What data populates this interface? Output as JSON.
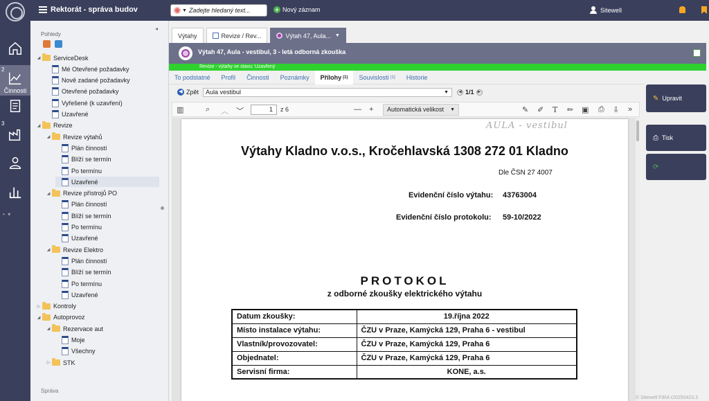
{
  "app": {
    "title": "Rektorát - správa budov"
  },
  "search": {
    "placeholder": "Zadejte hledaný text..."
  },
  "toolbar": {
    "new_record_label": "Nový záznam"
  },
  "user": {
    "name": "Sitewell"
  },
  "rail": {
    "items": [
      {
        "name": "home",
        "icon": "home-icon",
        "num": ""
      },
      {
        "name": "activities",
        "icon": "chart-line-icon",
        "num": "2",
        "label": "Činnosti"
      },
      {
        "name": "documents",
        "icon": "document-icon",
        "num": ""
      },
      {
        "name": "factory",
        "icon": "factory-icon",
        "num": "3"
      },
      {
        "name": "person",
        "icon": "person-icon",
        "num": ""
      },
      {
        "name": "stats",
        "icon": "bar-chart-icon",
        "num": ""
      }
    ]
  },
  "tree": {
    "header": "Pohledy",
    "footer": "Správa",
    "nodes": [
      {
        "label": "ServiceDesk",
        "type": "folder",
        "depth": 0,
        "expanded": true
      },
      {
        "label": "Mé Otevřené požadavky",
        "type": "doc",
        "depth": 1
      },
      {
        "label": "Nově zadané požadavky",
        "type": "doc",
        "depth": 1
      },
      {
        "label": "Otevřené požadavky",
        "type": "doc",
        "depth": 1
      },
      {
        "label": "Vyřešené (k uzavření)",
        "type": "doc",
        "depth": 1
      },
      {
        "label": "Uzavřené",
        "type": "doc",
        "depth": 1
      },
      {
        "label": "Revize",
        "type": "folder",
        "depth": 0,
        "expanded": true
      },
      {
        "label": "Revize výtahů",
        "type": "folder",
        "depth": 1,
        "expanded": true
      },
      {
        "label": "Plán činností",
        "type": "doc",
        "depth": 2
      },
      {
        "label": "Blíží se termín",
        "type": "doc",
        "depth": 2
      },
      {
        "label": "Po termínu",
        "type": "doc",
        "depth": 2
      },
      {
        "label": "Uzavřené",
        "type": "doc",
        "depth": 2,
        "selected": true
      },
      {
        "label": "Revize přístrojů PO",
        "type": "folder",
        "depth": 1,
        "expanded": true
      },
      {
        "label": "Plán činností",
        "type": "doc",
        "depth": 2
      },
      {
        "label": "Blíží se termín",
        "type": "doc",
        "depth": 2
      },
      {
        "label": "Po termínu",
        "type": "doc",
        "depth": 2
      },
      {
        "label": "Uzavřené",
        "type": "doc",
        "depth": 2
      },
      {
        "label": "Revize Elektro",
        "type": "folder",
        "depth": 1,
        "expanded": true
      },
      {
        "label": "Plán činností",
        "type": "doc",
        "depth": 2
      },
      {
        "label": "Blíží se termín",
        "type": "doc",
        "depth": 2
      },
      {
        "label": "Po termínu",
        "type": "doc",
        "depth": 2
      },
      {
        "label": "Uzavřené",
        "type": "doc",
        "depth": 2
      },
      {
        "label": "Kontroly",
        "type": "folder",
        "depth": 0,
        "expanded": false
      },
      {
        "label": "Autoprovoz",
        "type": "folder",
        "depth": 0,
        "expanded": true
      },
      {
        "label": "Rezervace aut",
        "type": "folder",
        "depth": 1,
        "expanded": true
      },
      {
        "label": "Moje",
        "type": "doc",
        "depth": 2
      },
      {
        "label": "Všechny",
        "type": "doc",
        "depth": 2
      },
      {
        "label": "STK",
        "type": "folder",
        "depth": 1,
        "expanded": false
      }
    ]
  },
  "tabs": [
    {
      "label": "Výtahy",
      "icon": ""
    },
    {
      "label": "Revize / Rev...",
      "icon": "table-icon"
    },
    {
      "label": "Výtah 47, Aula...",
      "icon": "purple-target-icon",
      "active": true
    }
  ],
  "record": {
    "title": "Výtah 47, Aula - vestibul, 3 - letá odborná zkouška",
    "status": "Revize - výtahy ve stavu: Uzavřený"
  },
  "subtabs": [
    {
      "label": "To podstatné",
      "count": ""
    },
    {
      "label": "Profil",
      "count": ""
    },
    {
      "label": "Činnosti",
      "count": ""
    },
    {
      "label": "Poznámky",
      "count": ""
    },
    {
      "label": "Přílohy",
      "count": "(1)",
      "active": true
    },
    {
      "label": "Souvislosti",
      "count": "(1)"
    },
    {
      "label": "Historie",
      "count": ""
    }
  ],
  "attachment": {
    "back_label": "Zpět",
    "file": "Aula vestibul",
    "pager": "1/1"
  },
  "pdf": {
    "page": "1",
    "of": "z 6",
    "zoom": "Automatická velikost",
    "handwritten": "AULA - vestibul",
    "title": "Výtahy Kladno v.o.s., Kročehlavská 1308 272 01 Kladno",
    "norm": "Dle ČSN 27 4007",
    "ev_lift_label": "Evidenční číslo výtahu:",
    "ev_lift_value": "43763004",
    "ev_protocol_label": "Evidenční číslo protokolu:",
    "ev_protocol_value": "59-10/2022",
    "protocol_title": "PROTOKOL",
    "protocol_sub": "z odborné zkoušky elektrického výtahu",
    "rows": [
      {
        "k": "Datum zkoušky:",
        "v": "19.října 2022",
        "center": true
      },
      {
        "k": "Místo instalace výtahu:",
        "v": "ČZU v Praze, Kamýcká 129, Praha 6 - vestibul",
        "center": false
      },
      {
        "k": "Vlastník/provozovatel:",
        "v": "ČZU v Praze, Kamýcká 129, Praha 6",
        "center": false
      },
      {
        "k": "Objednatel:",
        "v": "ČZU v Praze, Kamýcká 129, Praha 6",
        "center": false
      },
      {
        "k": "Servisní firma:",
        "v": "KONE, a.s.",
        "center": true
      }
    ]
  },
  "actions": {
    "edit_label": "Upravit",
    "print_label": "Tisk"
  },
  "footer": {
    "copyright": "© Sitewell FIRA r20250423.3"
  }
}
